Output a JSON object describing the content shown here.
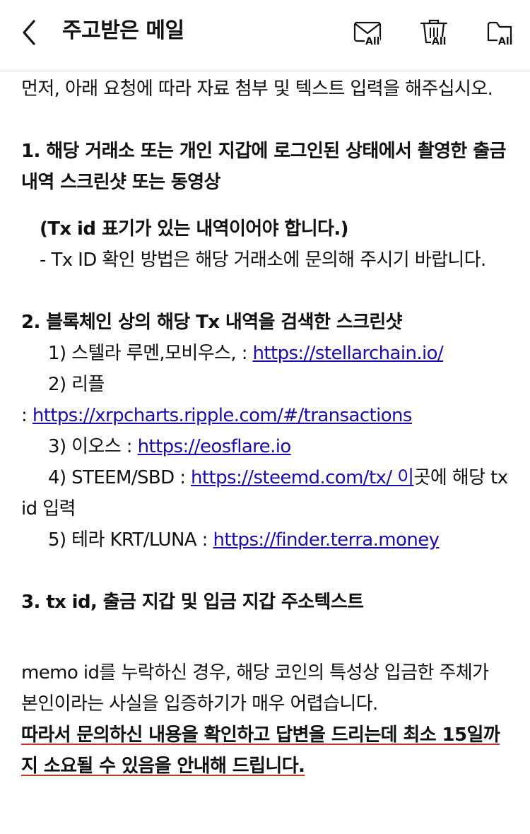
{
  "header": {
    "title": "주고받은 메일",
    "mail_all_label": "All",
    "trash_all_label": "All",
    "folder_all_label": "All"
  },
  "body": {
    "intro": "먼저, 아래 요청에 따라 자료 첨부 및 텍스트 입력을 해주십시오.",
    "item1_title": "1. 해당 거래소 또는 개인 지갑에 로그인된 상태에서 촬영한 출금 내역 스크린샷 또는 동영상",
    "item1_note": "(Tx id 표기가 있는 내역이어야 합니다.)",
    "item1_sub": "- Tx ID 확인 방법은 해당 거래소에 문의해 주시기 바랍니다.",
    "item2_title": "2. 블록체인 상의 해당 Tx 내역을 검색한 스크린샷",
    "l1_pre": "1) 스텔라 루멘,모비우스, : ",
    "l1_link": "https://stellarchain.io/",
    "l2_pre": "2) 리플",
    "l2_colon": ": ",
    "l2_link": "https://xrpcharts.ripple.com/#/transactions",
    "l3_pre": "3) 이오스 : ",
    "l3_link": "https://eosflare.io",
    "l4_pre": "4) STEEM/SBD : ",
    "l4_link": "https://steemd.com/tx/ 이",
    "l4_post": "곳에 해당 tx id 입력",
    "l5_pre": "5) 테라 KRT/LUNA : ",
    "l5_link": "https://finder.terra.money",
    "item3_title": "3. tx id, 출금 지갑 및 입금 지갑 주소텍스트",
    "memo_para": "memo id를 누락하신 경우, 해당 코인의 특성상 입금한 주체가 본인이라는 사실을 입증하기가 매우 어렵습니다.",
    "warning": "따라서 문의하신 내용을 확인하고 답변을 드리는데 최소 15일까지 소요될 수 있음을 안내해 드립니다."
  }
}
